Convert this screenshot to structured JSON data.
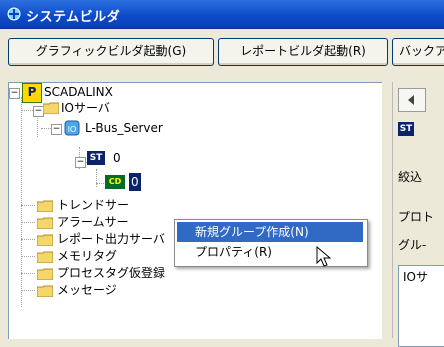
{
  "window": {
    "title": "システムビルダ"
  },
  "toolbar": {
    "graphic_builder": "グラフィックビルダ起動(G)",
    "report_builder": "レポートビルダ起動(R)",
    "backup": "バックア"
  },
  "tree": {
    "root": "SCADALINX",
    "io_server": "IOサーバ",
    "lbus_server": "L-Bus_Server",
    "st_label": "ST",
    "st_value": "0",
    "cd_label": "CD",
    "cd_value": "0",
    "items": [
      "トレンドサー",
      "アラームサー",
      "レポート出力サーバ",
      "メモリタグ",
      "プロセスタグ仮登録",
      "メッセージ"
    ]
  },
  "context_menu": {
    "items": [
      "新規グループ作成(N)",
      "プロパティ(R)"
    ]
  },
  "right_panel": {
    "tab_prefix": "ST",
    "filter_label": "絞込",
    "protocol_label": "プロト",
    "group_label": "グル-",
    "io_header": "IOサ"
  },
  "colors": {
    "titlebar": "#0d49c8",
    "selection": "#0a246a",
    "menu_highlight": "#316ac5"
  }
}
